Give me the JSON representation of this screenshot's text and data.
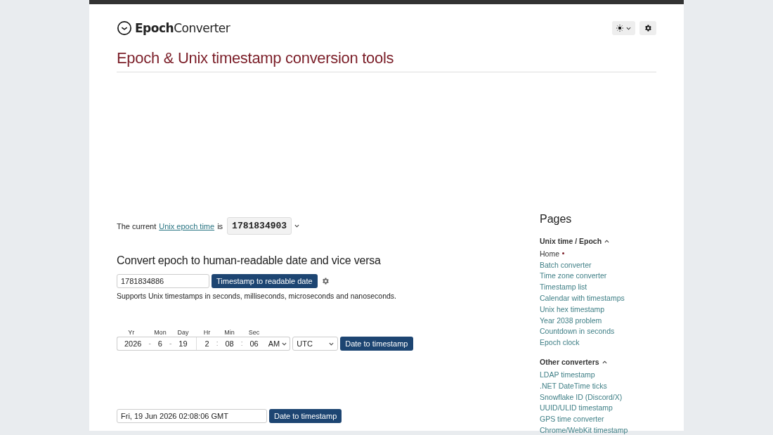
{
  "header": {
    "logo_bold": "Epoch",
    "logo_rest": "Converter"
  },
  "title": "Epoch & Unix timestamp conversion tools",
  "current": {
    "prefix": "The current",
    "link": "Unix epoch time",
    "suffix": "is",
    "value": "1781834903"
  },
  "converter": {
    "heading": "Convert epoch to human-readable date and vice versa",
    "input": "1781834886",
    "button": "Timestamp to readable date",
    "note": "Supports Unix timestamps in seconds, milliseconds, microseconds and nanoseconds."
  },
  "date_form": {
    "parts": [
      {
        "kind": "field",
        "label": "Yr",
        "value": "2026"
      },
      {
        "kind": "separator",
        "text": "-"
      },
      {
        "kind": "field",
        "label": "Mon",
        "value": "6"
      },
      {
        "kind": "separator",
        "text": "-"
      },
      {
        "kind": "field",
        "label": "Day",
        "value": "19"
      },
      {
        "kind": "divider"
      },
      {
        "kind": "field",
        "label": "Hr",
        "value": "2"
      },
      {
        "kind": "separator",
        "text": ":"
      },
      {
        "kind": "field",
        "label": "Min",
        "value": "08"
      },
      {
        "kind": "separator",
        "text": ":"
      },
      {
        "kind": "field",
        "label": "Sec",
        "value": "06"
      },
      {
        "kind": "select",
        "value": "AM"
      }
    ],
    "timezone": "UTC",
    "button": "Date to timestamp"
  },
  "text_form": {
    "input": "Fri, 19 Jun 2026 02:08:06 GMT",
    "button": "Date to timestamp"
  },
  "sidebar": {
    "heading": "Pages",
    "sections": [
      {
        "title": "Unix time / Epoch",
        "expanded": true,
        "items": [
          {
            "label": "Home",
            "selected": true
          },
          {
            "label": "Batch converter",
            "selected": false
          },
          {
            "label": "Time zone converter",
            "selected": false
          },
          {
            "label": "Timestamp list",
            "selected": false
          },
          {
            "label": "Calendar with timestamps",
            "selected": false
          },
          {
            "label": "Unix hex timestamp",
            "selected": false
          },
          {
            "label": "Year 2038 problem",
            "selected": false
          },
          {
            "label": "Countdown in seconds",
            "selected": false
          },
          {
            "label": "Epoch clock",
            "selected": false
          }
        ]
      },
      {
        "title": "Other converters",
        "expanded": true,
        "items": [
          {
            "label": "LDAP timestamp",
            "selected": false
          },
          {
            "label": ".NET DateTime ticks",
            "selected": false
          },
          {
            "label": "Snowflake ID (Discord/X)",
            "selected": false
          },
          {
            "label": "UUID/ULID timestamp",
            "selected": false
          },
          {
            "label": "GPS time converter",
            "selected": false
          },
          {
            "label": "Chrome/WebKit timestamp",
            "selected": false
          }
        ]
      }
    ]
  }
}
